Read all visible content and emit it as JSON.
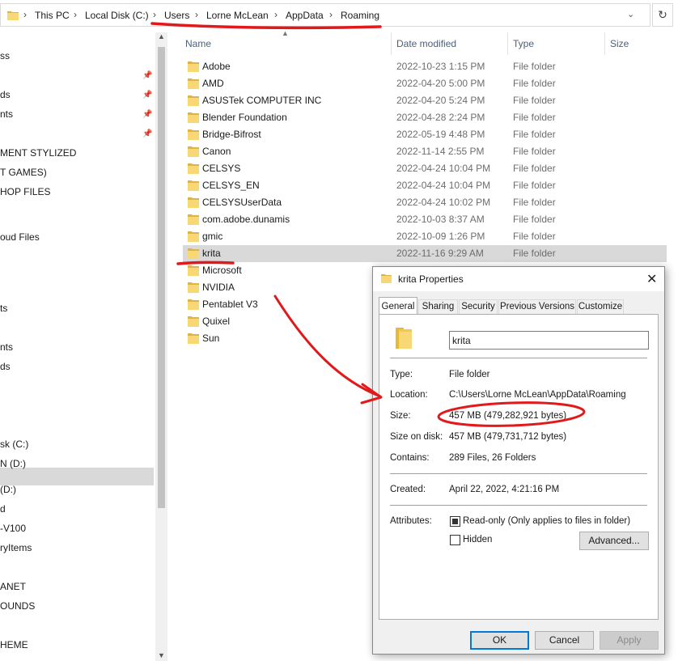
{
  "address_bar": {
    "crumbs": [
      "This PC",
      "Local Disk (C:)",
      "Users",
      "Lorne McLean",
      "AppData",
      "Roaming"
    ]
  },
  "nav_pane": {
    "items": [
      "ss",
      "ds",
      "nts",
      "MENT STYLIZED",
      "T GAMES)",
      "HOP FILES",
      "oud Files",
      "ts",
      "nts",
      "ds",
      "sk (C:)",
      "N (D:)",
      "(D:)",
      "d",
      "-V100",
      "ryItems",
      "ANET",
      "OUNDS",
      "HEME"
    ]
  },
  "columns": {
    "name": "Name",
    "date": "Date modified",
    "type": "Type",
    "size": "Size"
  },
  "files": [
    {
      "name": "Adobe",
      "date": "2022-10-23 1:15 PM",
      "type": "File folder"
    },
    {
      "name": "AMD",
      "date": "2022-04-20 5:00 PM",
      "type": "File folder"
    },
    {
      "name": "ASUSTek COMPUTER INC",
      "date": "2022-04-20 5:24 PM",
      "type": "File folder"
    },
    {
      "name": "Blender Foundation",
      "date": "2022-04-28 2:24 PM",
      "type": "File folder"
    },
    {
      "name": "Bridge-Bifrost",
      "date": "2022-05-19 4:48 PM",
      "type": "File folder"
    },
    {
      "name": "Canon",
      "date": "2022-11-14 2:55 PM",
      "type": "File folder"
    },
    {
      "name": "CELSYS",
      "date": "2022-04-24 10:04 PM",
      "type": "File folder"
    },
    {
      "name": "CELSYS_EN",
      "date": "2022-04-24 10:04 PM",
      "type": "File folder"
    },
    {
      "name": "CELSYSUserData",
      "date": "2022-04-24 10:02 PM",
      "type": "File folder"
    },
    {
      "name": "com.adobe.dunamis",
      "date": "2022-10-03 8:37 AM",
      "type": "File folder"
    },
    {
      "name": "gmic",
      "date": "2022-10-09 1:26 PM",
      "type": "File folder"
    },
    {
      "name": "krita",
      "date": "2022-11-16 9:29 AM",
      "type": "File folder"
    },
    {
      "name": "Microsoft",
      "date": "",
      "type": ""
    },
    {
      "name": "NVIDIA",
      "date": "",
      "type": ""
    },
    {
      "name": "Pentablet V3",
      "date": "",
      "type": ""
    },
    {
      "name": "Quixel",
      "date": "",
      "type": ""
    },
    {
      "name": "Sun",
      "date": "",
      "type": ""
    }
  ],
  "dialog": {
    "title": "krita Properties",
    "tabs": [
      "General",
      "Sharing",
      "Security",
      "Previous Versions",
      "Customize"
    ],
    "folder_name": "krita",
    "props": {
      "type_label": "Type:",
      "type_value": "File folder",
      "location_label": "Location:",
      "location_value": "C:\\Users\\Lorne McLean\\AppData\\Roaming",
      "size_label": "Size:",
      "size_value": "457 MB (479,282,921 bytes)",
      "size_on_disk_label": "Size on disk:",
      "size_on_disk_value": "457 MB (479,731,712 bytes)",
      "contains_label": "Contains:",
      "contains_value": "289 Files, 26 Folders",
      "created_label": "Created:",
      "created_value": "April 22, 2022, 4:21:16 PM",
      "attributes_label": "Attributes:",
      "readonly_label": "Read-only (Only applies to files in folder)",
      "hidden_label": "Hidden",
      "advanced_label": "Advanced..."
    },
    "buttons": {
      "ok": "OK",
      "cancel": "Cancel",
      "apply": "Apply"
    }
  },
  "icons": {
    "folder": "folder-icon",
    "pin": "pin-icon",
    "refresh": "refresh-icon",
    "close": "close-icon",
    "chevron": "chevron-down-icon"
  },
  "colors": {
    "folder_yellow": "#f8d775",
    "annotation_red": "#e2191b",
    "selection": "#d9d9d9",
    "ok_border": "#0078d7"
  }
}
